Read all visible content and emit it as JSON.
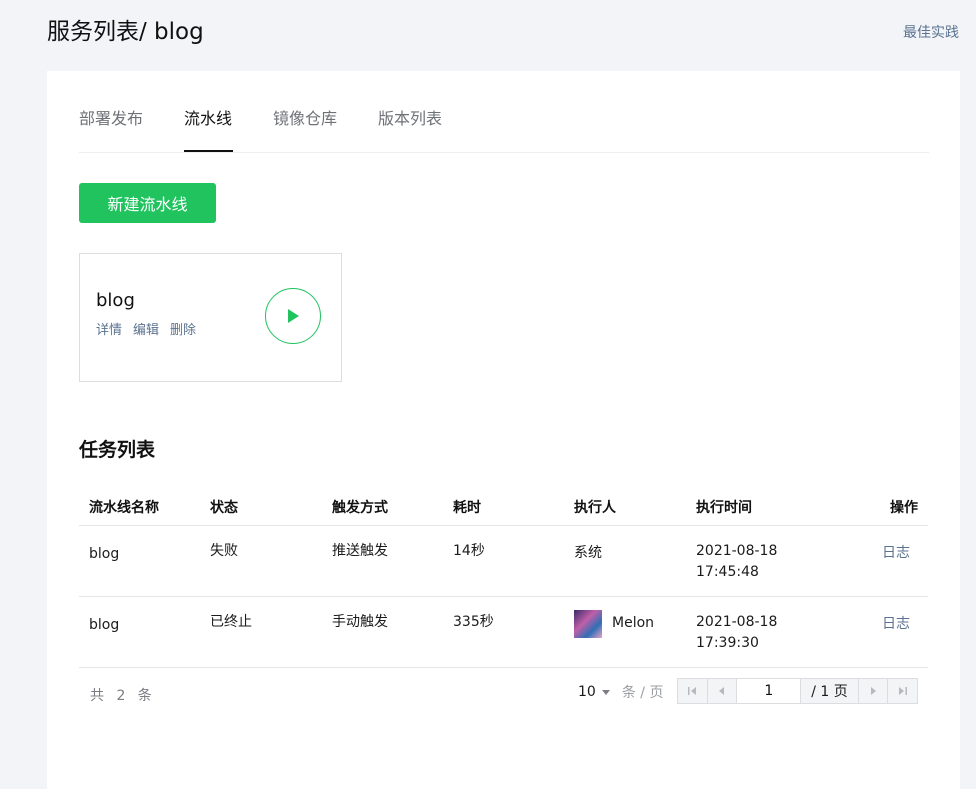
{
  "header": {
    "title": "服务列表/ blog",
    "best_practice": "最佳实践"
  },
  "tabs": [
    {
      "label": "部署发布",
      "active": false
    },
    {
      "label": "流水线",
      "active": true
    },
    {
      "label": "镜像仓库",
      "active": false
    },
    {
      "label": "版本列表",
      "active": false
    }
  ],
  "new_pipeline_label": "新建流水线",
  "pipeline": {
    "name": "blog",
    "actions": [
      "详情",
      "编辑",
      "删除"
    ]
  },
  "tasks": {
    "title": "任务列表",
    "columns": [
      "流水线名称",
      "状态",
      "触发方式",
      "耗时",
      "执行人",
      "执行时间",
      "操作"
    ],
    "rows": [
      {
        "name": "blog",
        "status": "失败",
        "trigger": "推送触发",
        "duration": "14秒",
        "executor": "系统",
        "has_avatar": false,
        "date": "2021-08-18",
        "time": "17:45:48",
        "action": "日志"
      },
      {
        "name": "blog",
        "status": "已终止",
        "trigger": "手动触发",
        "duration": "335秒",
        "executor": "Melon",
        "has_avatar": true,
        "date": "2021-08-18",
        "time": "17:39:30",
        "action": "日志"
      }
    ]
  },
  "pagination": {
    "total_text": "共 2 条",
    "page_size": "10",
    "per_page_label": "条 / 页",
    "current_page": "1",
    "total_pages": "/ 1 页"
  },
  "colors": {
    "accent_green": "#21c35f",
    "link_blue": "#5a7290"
  }
}
